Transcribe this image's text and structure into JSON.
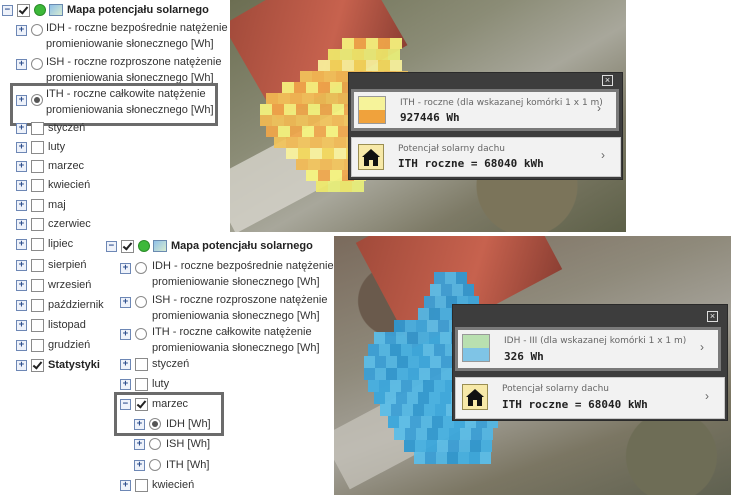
{
  "panel1": {
    "title": "Mapa potencjału solarnego",
    "radios": [
      {
        "line1": "IDH - roczne bezpośrednie natężenie",
        "line2": "promieniowanie słonecznego [Wh]",
        "selected": false
      },
      {
        "line1": "ISH - roczne rozproszone natężenie",
        "line2": "promieniowania słonecznego [Wh]",
        "selected": false
      },
      {
        "line1": "ITH - roczne całkowite natężenie",
        "line2": "promieniowania słonecznego [Wh]",
        "selected": true
      }
    ],
    "months": [
      "styczeń",
      "luty",
      "marzec",
      "kwiecień",
      "maj",
      "czerwiec",
      "lipiec",
      "sierpień",
      "wrzesień",
      "październik",
      "listopad",
      "grudzień"
    ],
    "stats": "Statystyki"
  },
  "panel2": {
    "title": "Mapa potencjału solarnego",
    "radios": [
      {
        "line1": "IDH - roczne bezpośrednie natężenie",
        "line2": "promieniowanie słonecznego [Wh]"
      },
      {
        "line1": "ISH - roczne rozproszone natężenie",
        "line2": "promieniowania słonecznego [Wh]"
      },
      {
        "line1": "ITH - roczne całkowite natężenie",
        "line2": "promieniowania słonecznego [Wh]"
      }
    ],
    "months_before": [
      "styczeń",
      "luty"
    ],
    "expanded_month": "marzec",
    "sub_layers": [
      {
        "label": "IDH [Wh]",
        "selected": true
      },
      {
        "label": "ISH [Wh]",
        "selected": false
      },
      {
        "label": "ITH [Wh]",
        "selected": false
      }
    ],
    "months_after": [
      "kwiecień"
    ]
  },
  "popup1": {
    "close": "×",
    "item1_small": "ITH - roczne (dla wskazanej komórki 1 x 1 m)",
    "item1_value": "927446 Wh",
    "item2_small": "Potencjał solarny dachu",
    "item2_value": "ITH roczne = 68040 kWh",
    "chevron": "›"
  },
  "popup2": {
    "close": "×",
    "item1_small": "IDH - III (dla wskazanej komórki 1 x 1 m)",
    "item1_value": "326 Wh",
    "item2_small": "Potencjał solarny dachu",
    "item2_value": "ITH roczne = 68040 kWh",
    "chevron": "›"
  },
  "colors": {
    "heat_yellow": "#f3f06a",
    "heat_orange": "#f0a23c",
    "heat_blue": "#3aa6dc",
    "popup_bg": "#3d3d3d"
  }
}
